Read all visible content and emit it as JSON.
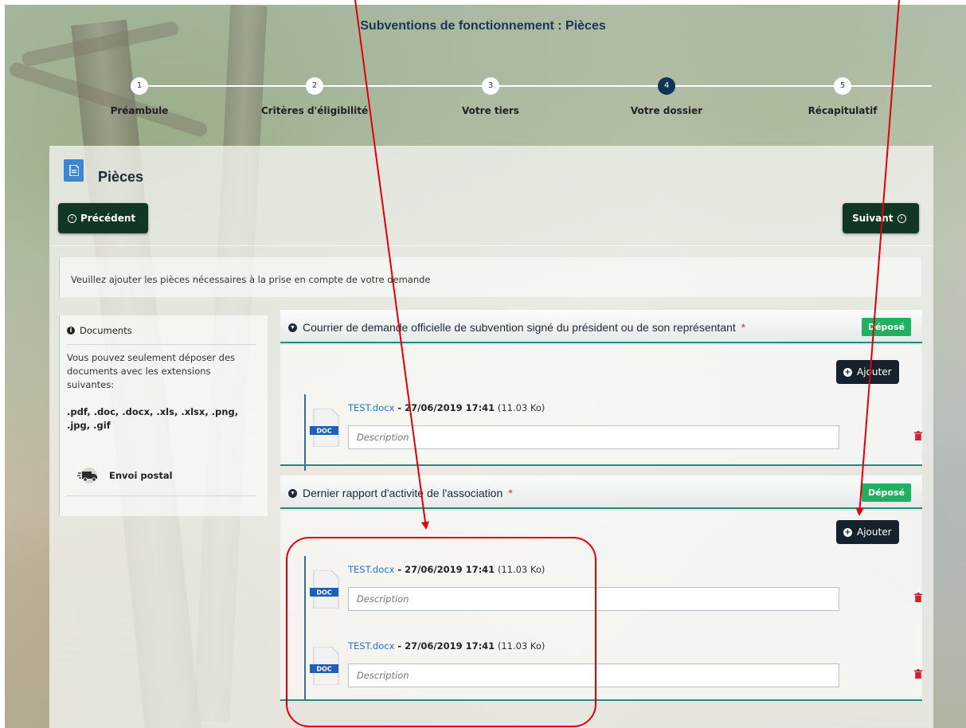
{
  "page_title": "Subventions de fonctionnement : Pièces",
  "stepper": {
    "steps": [
      {
        "number": "1",
        "label": "Préambule"
      },
      {
        "number": "2",
        "label": "Critères d'éligibilité"
      },
      {
        "number": "3",
        "label": "Votre tiers"
      },
      {
        "number": "4",
        "label": "Votre dossier"
      },
      {
        "number": "5",
        "label": "Récapitulatif"
      }
    ],
    "active_step": "4"
  },
  "section": {
    "title": "Pièces"
  },
  "nav": {
    "prev_label": "Précédent",
    "next_label": "Suivant"
  },
  "info": {
    "text": "Veuillez ajouter les pièces nécessaires à la prise en compte de votre demande"
  },
  "sidebar": {
    "heading": "Documents",
    "text": "Vous pouvez seulement déposer des documents avec les extensions suivantes:",
    "extensions": ".pdf, .doc, .docx, .xls, .xlsx, .png, .jpg, .gif",
    "postal_label": "Envoi postal"
  },
  "documents": [
    {
      "title": "Courrier de demande officielle de subvention signé du président ou de son représentant",
      "required_mark": "*",
      "status": "Déposé",
      "add_label": "Ajouter",
      "files": [
        {
          "name": "TEST.docx",
          "datetime": " - 27/06/2019 17:41",
          "size": " (11.03 Ko)",
          "type": "DOC",
          "description_placeholder": "Description"
        }
      ]
    },
    {
      "title": "Dernier rapport d'activité de l'association",
      "required_mark": "*",
      "status": "Déposé",
      "add_label": "Ajouter",
      "files": [
        {
          "name": "TEST.docx",
          "datetime": " - 27/06/2019 17:41",
          "size": " (11.03 Ko)",
          "type": "DOC",
          "description_placeholder": "Description"
        },
        {
          "name": "TEST.docx",
          "datetime": " - 27/06/2019 17:41",
          "size": " (11.03 Ko)",
          "type": "DOC",
          "description_placeholder": "Description"
        }
      ]
    }
  ],
  "colors": {
    "primary_dark": "#103723",
    "step_active": "#0f3552",
    "badge_green": "#21b061",
    "accent_line": "#2a8a7b",
    "annotation_red": "#e0000a"
  }
}
